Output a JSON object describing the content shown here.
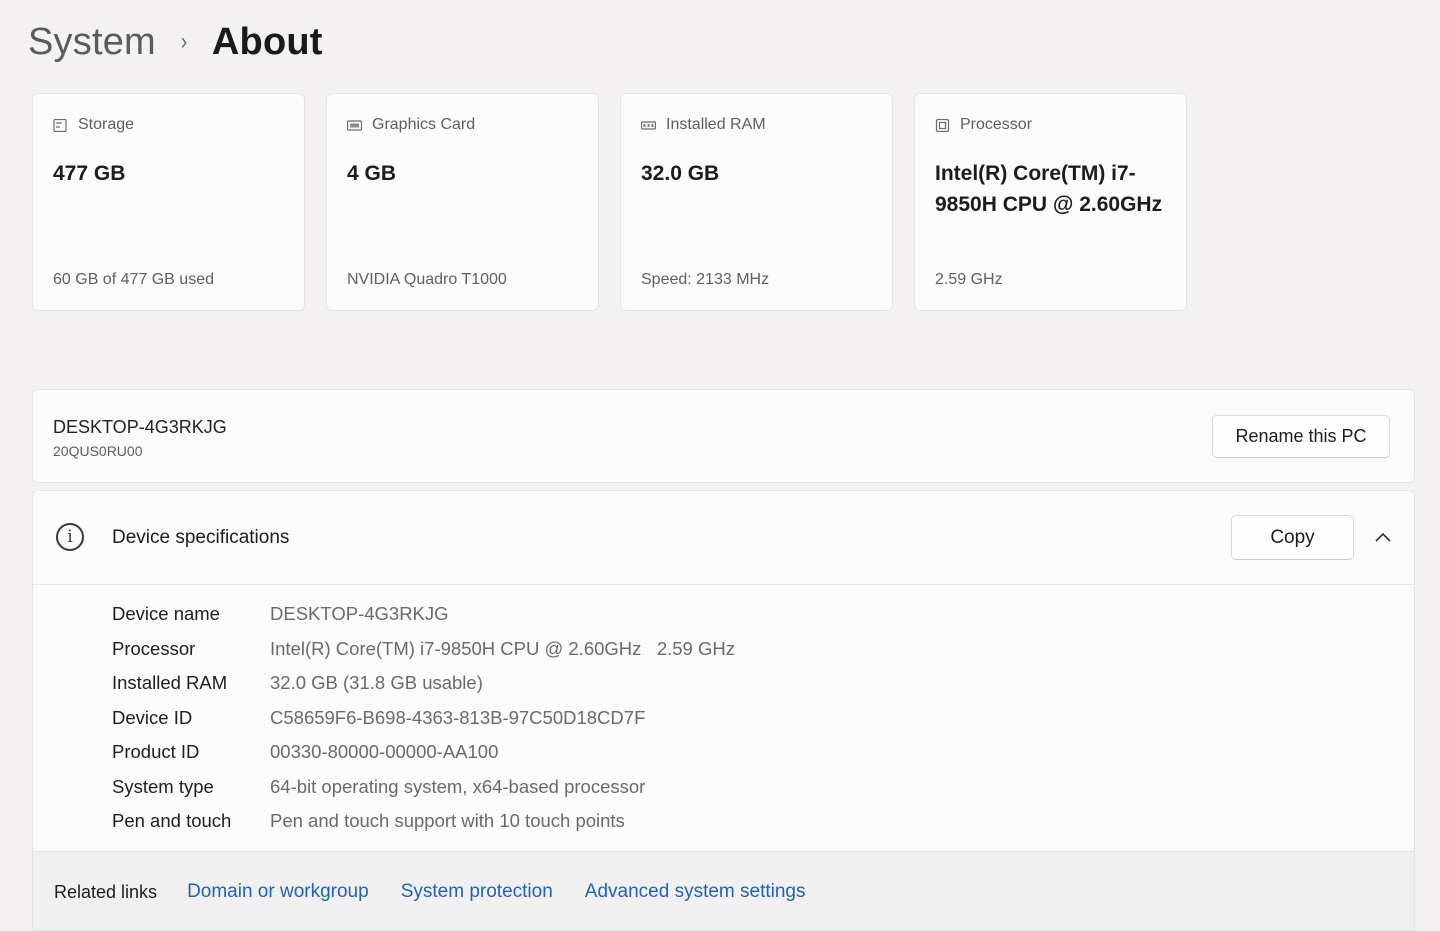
{
  "breadcrumb": {
    "parent": "System",
    "separator": "›",
    "current": "About"
  },
  "cards": [
    {
      "icon": "storage-icon",
      "label": "Storage",
      "value": "477 GB",
      "sub": "60 GB of 477 GB used"
    },
    {
      "icon": "graphics-card-icon",
      "label": "Graphics Card",
      "value": "4 GB",
      "sub": "NVIDIA Quadro T1000"
    },
    {
      "icon": "ram-icon",
      "label": "Installed RAM",
      "value": "32.0 GB",
      "sub": "Speed: 2133 MHz"
    },
    {
      "icon": "processor-icon",
      "label": "Processor",
      "value": "Intel(R) Core(TM) i7-9850H CPU @ 2.60GHz",
      "sub": "2.59 GHz"
    }
  ],
  "device": {
    "name": "DESKTOP-4G3RKJG",
    "model": "20QUS0RU00",
    "rename_label": "Rename this PC"
  },
  "specs": {
    "title": "Device specifications",
    "copy_label": "Copy",
    "rows": [
      {
        "label": "Device name",
        "value": "DESKTOP-4G3RKJG"
      },
      {
        "label": "Processor",
        "value": "Intel(R) Core(TM) i7-9850H CPU @ 2.60GHz   2.59 GHz"
      },
      {
        "label": "Installed RAM",
        "value": "32.0 GB (31.8 GB usable)"
      },
      {
        "label": "Device ID",
        "value": "C58659F6-B698-4363-813B-97C50D18CD7F"
      },
      {
        "label": "Product ID",
        "value": "00330-80000-00000-AA100"
      },
      {
        "label": "System type",
        "value": "64-bit operating system, x64-based processor"
      },
      {
        "label": "Pen and touch",
        "value": "Pen and touch support with 10 touch points"
      }
    ]
  },
  "related": {
    "title": "Related links",
    "links": [
      "Domain or workgroup",
      "System protection",
      "Advanced system settings"
    ]
  },
  "colors": {
    "link": "#1f63b5",
    "background": "#f3f1f2",
    "card": "#fbfbfb"
  }
}
